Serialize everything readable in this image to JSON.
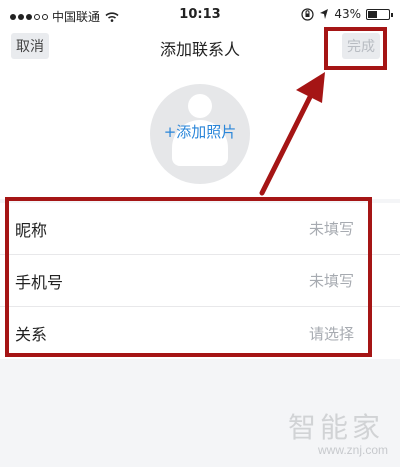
{
  "status_bar": {
    "carrier": "中国联通",
    "time": "10:13",
    "battery": "43%",
    "battery_level": 0.43
  },
  "nav": {
    "title": "添加联系人",
    "cancel_label": "取消",
    "done_label": "完成"
  },
  "photo": {
    "add_label": "+添加照片"
  },
  "fields": [
    {
      "label": "昵称",
      "value": "未填写"
    },
    {
      "label": "手机号",
      "value": "未填写"
    },
    {
      "label": "关系",
      "value": "请选择"
    }
  ],
  "watermark": {
    "text": "智能家",
    "url": "www.znj.com"
  },
  "colors": {
    "accent": "#2a86d9",
    "annotation": "#a51515",
    "placeholder": "#a7abb1"
  }
}
